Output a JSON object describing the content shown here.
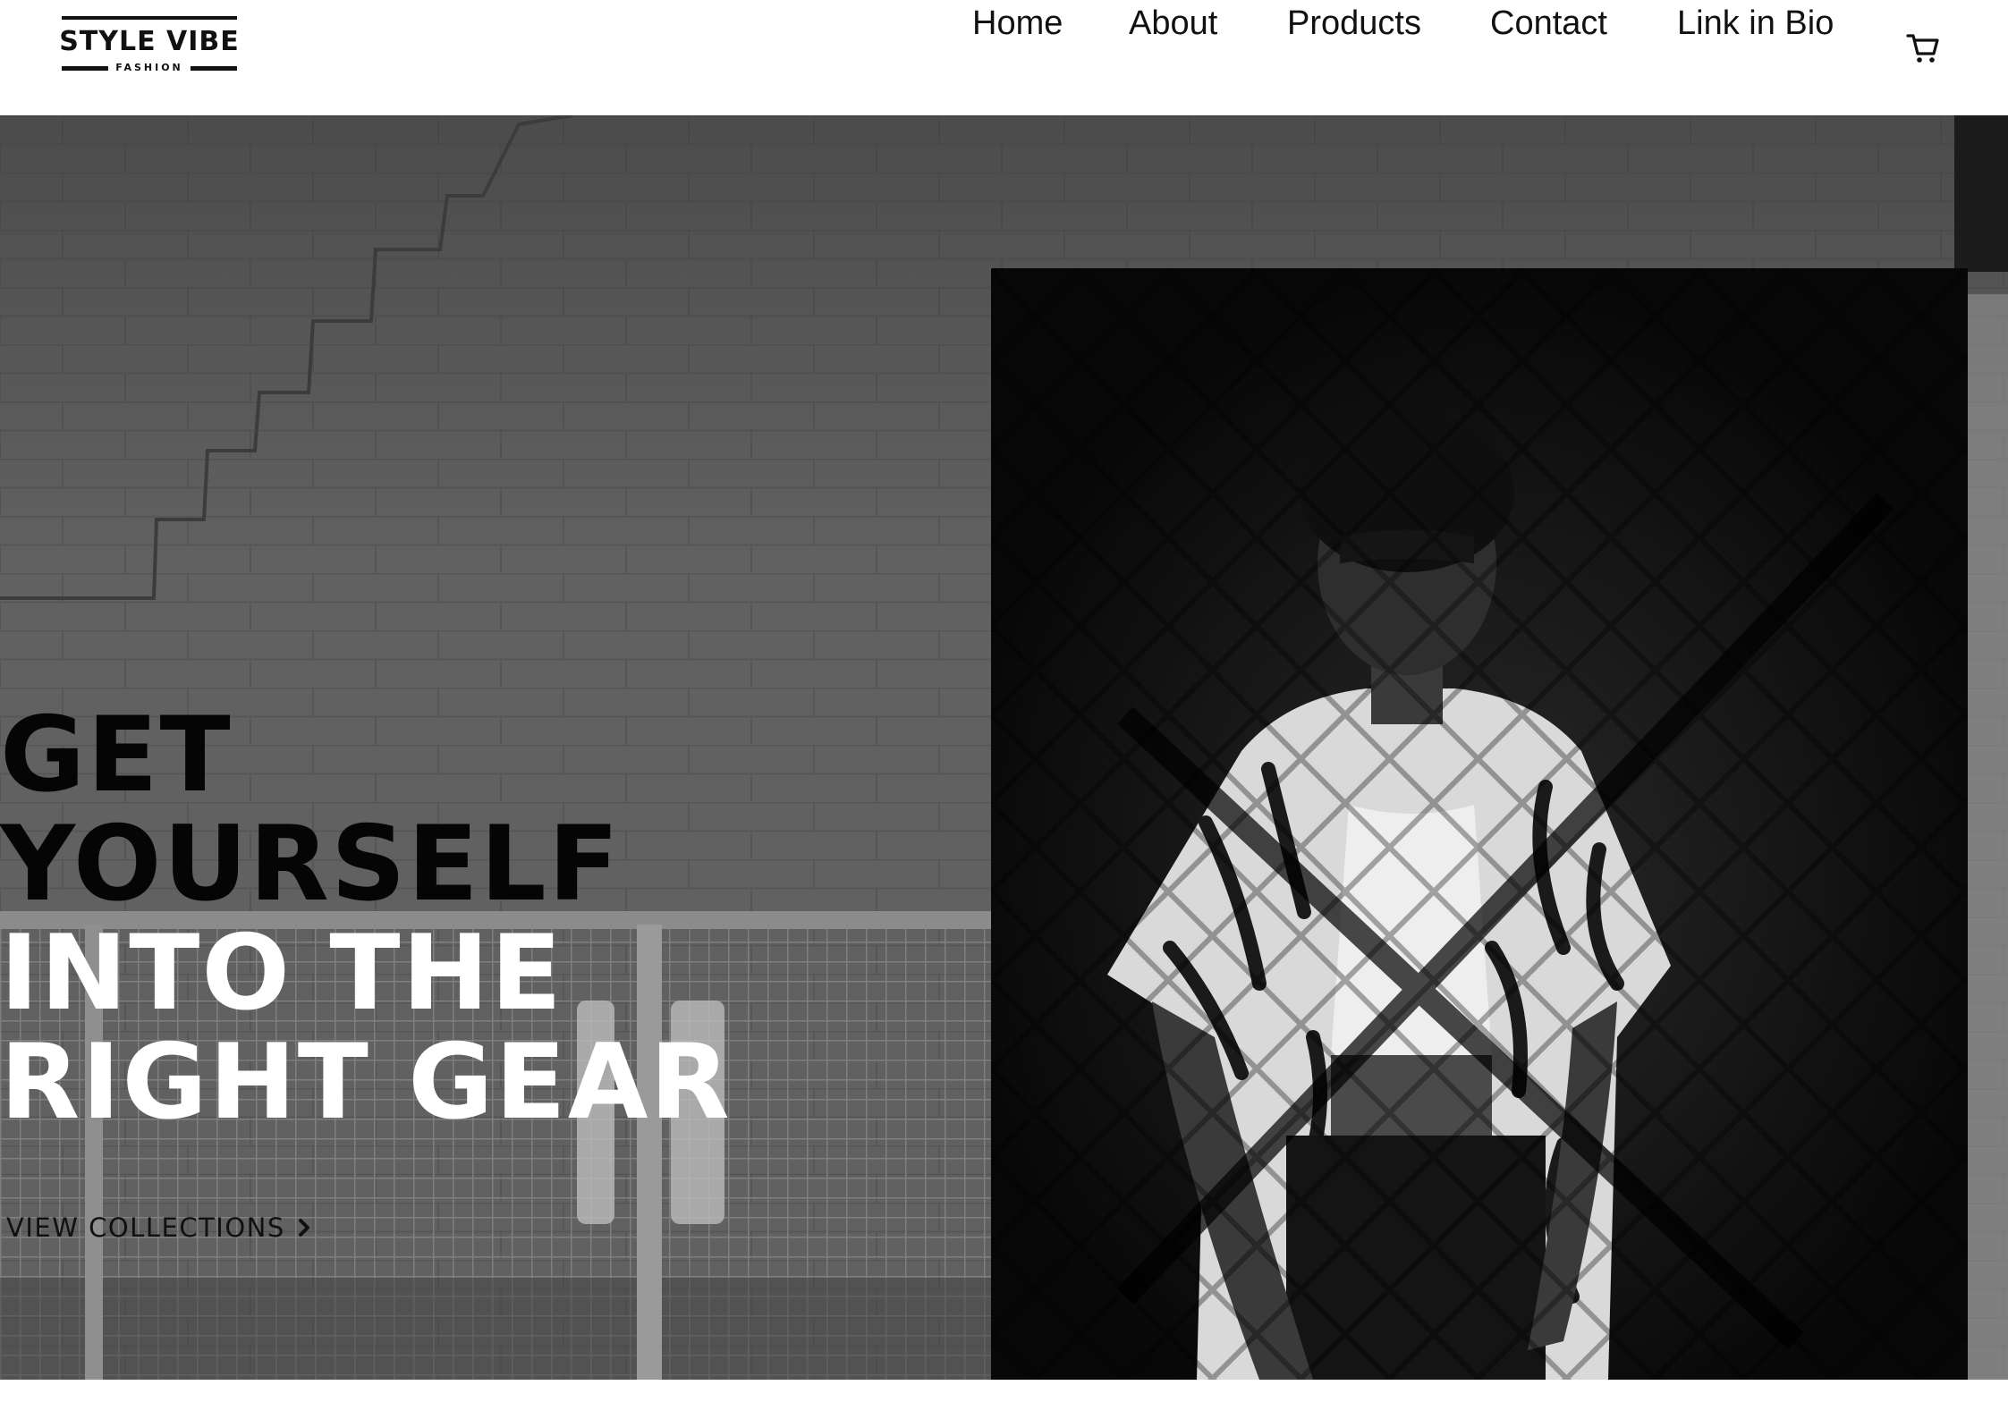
{
  "brand": {
    "name": "STYLE VIBE",
    "tagline": "FASHION"
  },
  "nav": {
    "items": [
      {
        "label": "Home"
      },
      {
        "label": "About"
      },
      {
        "label": "Products"
      },
      {
        "label": "Contact"
      },
      {
        "label": "Link in Bio"
      }
    ],
    "cart_icon": "shopping-cart-icon"
  },
  "hero": {
    "headline": {
      "line1": "GET",
      "line2": "YOURSELF",
      "line3": "INTO THE",
      "line4": "RIGHT GEAR"
    },
    "cta": {
      "label": "VIEW COLLECTIONS",
      "icon": "chevron-right-icon"
    },
    "colors": {
      "headline_dark": "#050505",
      "headline_light": "#ffffff",
      "background": "#5f5f5f"
    }
  }
}
